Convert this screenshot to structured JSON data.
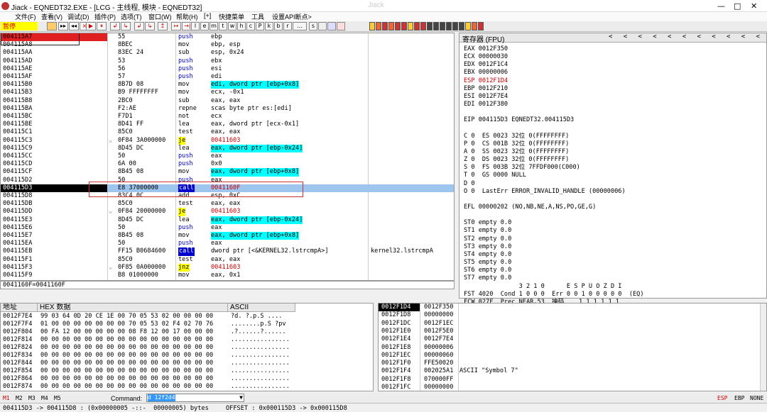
{
  "window": {
    "app_icon": "beetle-icon",
    "title": "Jiack - EQNEDT32.EXE - [LCG - 主线程, 模块 - EQNEDT32]",
    "center_title": "Jiack",
    "min": "—",
    "max": "□",
    "close": "✕"
  },
  "menu": [
    "文件(F)",
    "查看(V)",
    "调试(D)",
    "插件(P)",
    "选项(T)",
    "窗口(W)",
    "帮助(H)",
    "[+]",
    "快捷菜单",
    "工具",
    "设置API断点>"
  ],
  "toolbar": {
    "state": "暂停",
    "buttons": [
      "▸▸",
      "◂◂",
      "×",
      "▶",
      "⏸",
      "↲",
      "↳",
      "↲",
      "↳",
      "↥",
      "↦",
      "→|"
    ],
    "letters": [
      "l",
      "e",
      "m",
      "t",
      "w",
      "h",
      "c",
      "P",
      "k",
      "b",
      "r",
      "...",
      "s"
    ],
    "right_icons": 18
  },
  "cpu": {
    "rows": [
      {
        "addr": "004115A7",
        "hex": "55",
        "mn": "push",
        "op": "ebp",
        "addr_style": "red"
      },
      {
        "addr": "004115A8",
        "hex": "8BEC",
        "mn": "mov",
        "op": "ebp, esp"
      },
      {
        "addr": "004115AA",
        "hex": "83EC 24",
        "mn": "sub",
        "op": "esp, 0x24"
      },
      {
        "addr": "004115AD",
        "hex": "53",
        "mn": "push",
        "op": "ebx"
      },
      {
        "addr": "004115AE",
        "hex": "56",
        "mn": "push",
        "op": "esi"
      },
      {
        "addr": "004115AF",
        "hex": "57",
        "mn": "push",
        "op": "edi"
      },
      {
        "addr": "004115B0",
        "hex": "8B7D 08",
        "mn": "mov",
        "op": "edi, dword ptr [ebp+0x8]",
        "op_style": "mem"
      },
      {
        "addr": "004115B3",
        "hex": "B9 FFFFFFFF",
        "mn": "mov",
        "op": "ecx, -0x1"
      },
      {
        "addr": "004115B8",
        "hex": "2BC0",
        "mn": "sub",
        "op": "eax, eax"
      },
      {
        "addr": "004115BA",
        "hex": "F2:AE",
        "mn": "repne",
        "op": "scas byte ptr es:[edi]"
      },
      {
        "addr": "004115BC",
        "hex": "F7D1",
        "mn": "not",
        "op": "ecx"
      },
      {
        "addr": "004115BE",
        "hex": "8D41 FF",
        "mn": "lea",
        "op": "eax, dword ptr [ecx-0x1]"
      },
      {
        "addr": "004115C1",
        "hex": "85C0",
        "mn": "test",
        "op": "eax, eax"
      },
      {
        "addr": "004115C3",
        "hex": "0F84 3A000000",
        "mn": "je",
        "op": "00411603",
        "mn_style": "jump"
      },
      {
        "addr": "004115C9",
        "hex": "8D45 DC",
        "mn": "lea",
        "op": "eax, dword ptr [ebp-0x24]",
        "op_style": "mem"
      },
      {
        "addr": "004115CC",
        "hex": "50",
        "mn": "push",
        "op": "eax"
      },
      {
        "addr": "004115CD",
        "hex": "6A 00",
        "mn": "push",
        "op": "0x0"
      },
      {
        "addr": "004115CF",
        "hex": "8B45 08",
        "mn": "mov",
        "op": "eax, dword ptr [ebp+0x8]",
        "op_style": "mem"
      },
      {
        "addr": "004115D2",
        "hex": "50",
        "mn": "push",
        "op": "eax"
      },
      {
        "addr": "004115D3",
        "hex": "E8 37000000",
        "mn": "call",
        "op": "0041160F",
        "addr_style": "cur",
        "mn_style": "call",
        "row_style": "sel"
      },
      {
        "addr": "004115D8",
        "hex": "83C4 0C",
        "mn": "add",
        "op": "esp, 0xC"
      },
      {
        "addr": "004115DB",
        "hex": "85C0",
        "mn": "test",
        "op": "eax, eax"
      },
      {
        "addr": "004115DD",
        "hex": "0F84 20000000",
        "mn": "je",
        "op": "00411603",
        "mn_style": "jump"
      },
      {
        "addr": "004115E3",
        "hex": "8D45 DC",
        "mn": "lea",
        "op": "eax, dword ptr [ebp-0x24]",
        "op_style": "mem"
      },
      {
        "addr": "004115E6",
        "hex": "50",
        "mn": "push",
        "op": "eax"
      },
      {
        "addr": "004115E7",
        "hex": "8B45 08",
        "mn": "mov",
        "op": "eax, dword ptr [ebp+0x8]",
        "op_style": "mem"
      },
      {
        "addr": "004115EA",
        "hex": "50",
        "mn": "push",
        "op": "eax"
      },
      {
        "addr": "004115EB",
        "hex": "FF15 B0684600",
        "mn": "call",
        "op": "dword ptr [<&KERNEL32.lstrcmpA>]",
        "mn_style": "call",
        "comment": "kernel32.lstrcmpA"
      },
      {
        "addr": "004115F1",
        "hex": "85C0",
        "mn": "test",
        "op": "eax, eax"
      },
      {
        "addr": "004115F3",
        "hex": "0F85 0A000000",
        "mn": "jnz",
        "op": "00411603",
        "mn_style": "jump"
      },
      {
        "addr": "004115F9",
        "hex": "B8 01000000",
        "mn": "mov",
        "op": "eax, 0x1"
      }
    ]
  },
  "info_line": "0041160F=0041160F",
  "registers": {
    "header": "寄存器 (FPU)",
    "header_arrows": "<  <  <  <  <  <  <  <  <  <  <",
    "lines": [
      "EAX 0012F350",
      "ECX 00000030",
      "EDX 0012F1C4",
      "EBX 00000006",
      "ESP 0012F1D4",
      "EBP 0012F210",
      "ESI 0012F7E4",
      "EDI 0012F380",
      "",
      "EIP 004115D3 EQNEDT32.004115D3",
      "",
      "C 0  ES 0023 32位 0(FFFFFFFF)",
      "P 0  CS 001B 32位 0(FFFFFFFF)",
      "A 0  SS 0023 32位 0(FFFFFFFF)",
      "Z 0  DS 0023 32位 0(FFFFFFFF)",
      "S 0  FS 003B 32位 7FFDF000(C000)",
      "T 0  GS 0000 NULL",
      "D 0",
      "O 0  LastErr ERROR_INVALID_HANDLE (00000006)",
      "",
      "EFL 00000202 (NO,NB,NE,A,NS,PO,GE,G)",
      "",
      "ST0 empty 0.0",
      "ST1 empty 0.0",
      "ST2 empty 0.0",
      "ST3 empty 0.0",
      "ST4 empty 0.0",
      "ST5 empty 0.0",
      "ST6 empty 0.0",
      "ST7 empty 0.0",
      "               3 2 1 0      E S P U O Z D I",
      "FST 4020  Cond 1 0 0 0  Err 0 0 1 0 0 0 0 0  (EQ)",
      "FCW 027F  Prec NEAR,53  掩码    1 1 1 1 1 1"
    ]
  },
  "dump": {
    "col_addr": "地址",
    "col_hex": "HEX 数据",
    "col_ascii": "ASCII",
    "rows": [
      {
        "a": "0012F7E4",
        "h": "99 03 64 0D 20 CE 1E 00 70 05 53 02 00 00 00 00",
        "s": "?d. ?.p.S ...."
      },
      {
        "a": "0012F7F4",
        "h": "01 00 00 00 00 00 00 00 70 05 53 02 F4 02 70 76",
        "s": "........p.S ?pv"
      },
      {
        "a": "0012F804",
        "h": "00 FA 12 00 00 00 00 00 08 F8 12 00 17 00 00 00",
        "s": ".?......?......"
      },
      {
        "a": "0012F814",
        "h": "00 00 00 00 00 00 00 00 00 00 00 00 00 00 00 00",
        "s": "................"
      },
      {
        "a": "0012F824",
        "h": "00 00 00 00 00 00 00 00 00 00 00 00 00 00 00 00",
        "s": "................"
      },
      {
        "a": "0012F834",
        "h": "00 00 00 00 00 00 00 00 00 00 00 00 00 00 00 00",
        "s": "................"
      },
      {
        "a": "0012F844",
        "h": "00 00 00 00 00 00 00 00 00 00 00 00 00 00 00 00",
        "s": "................"
      },
      {
        "a": "0012F854",
        "h": "00 00 00 00 00 00 00 00 00 00 00 00 00 00 00 00",
        "s": "................"
      },
      {
        "a": "0012F864",
        "h": "00 00 00 00 00 00 00 00 00 00 00 00 00 00 00 00",
        "s": "................"
      },
      {
        "a": "0012F874",
        "h": "00 00 00 00 00 00 00 00 00 00 00 00 00 00 00 00",
        "s": "................"
      }
    ]
  },
  "stack": {
    "rows": [
      {
        "a": "0012F1D4",
        "v": "0012F350",
        "c": "",
        "sel": true
      },
      {
        "a": "0012F1D8",
        "v": "00000000",
        "c": ""
      },
      {
        "a": "0012F1DC",
        "v": "0012F1EC",
        "c": ""
      },
      {
        "a": "0012F1E0",
        "v": "0012F5E0",
        "c": ""
      },
      {
        "a": "0012F1E4",
        "v": "0012F7E4",
        "c": ""
      },
      {
        "a": "0012F1E8",
        "v": "00000006",
        "c": ""
      },
      {
        "a": "0012F1EC",
        "v": "00000060",
        "c": ""
      },
      {
        "a": "0012F1F0",
        "v": "FFE50020",
        "c": ""
      },
      {
        "a": "0012F1F4",
        "v": "002025A1",
        "c": "ASCII \"Symbol 7\""
      },
      {
        "a": "0012F1F8",
        "v": "070000FF",
        "c": ""
      },
      {
        "a": "0012F1FC",
        "v": "00000000",
        "c": ""
      }
    ]
  },
  "cmd": {
    "tabs": [
      "M1",
      "M2",
      "M3",
      "M4",
      "M5"
    ],
    "label": "Command:",
    "value": "d 12f2d4",
    "right": [
      "ESP",
      "EBP",
      "NONE"
    ]
  },
  "status": {
    "left": "004115D3 -> 004115D8 : (0x00000005 -::-  00000005) bytes",
    "right": "OFFSET : 0x000115D3 -> 0x000115D8"
  },
  "colors": {
    "accent_red": "#e02020",
    "call": "#0000cc",
    "mem": "#00ffff",
    "jump": "#ffff00"
  }
}
